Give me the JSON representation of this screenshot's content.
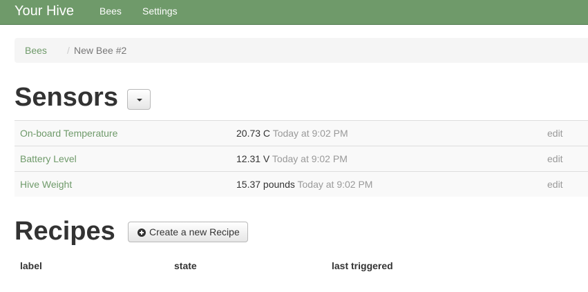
{
  "navbar": {
    "brand": "Your Hive",
    "links": [
      "Bees",
      "Settings"
    ]
  },
  "breadcrumb": {
    "items": [
      "Bees",
      "New Bee #2"
    ],
    "separator": "/"
  },
  "sensors": {
    "heading": "Sensors",
    "dropdown_icon": "caret-down-icon",
    "rows": [
      {
        "name": "On-board Temperature",
        "value": "20.73 C",
        "time": "Today at 9:02 PM",
        "action": "edit"
      },
      {
        "name": "Battery Level",
        "value": "12.31 V",
        "time": "Today at 9:02 PM",
        "action": "edit"
      },
      {
        "name": "Hive Weight",
        "value": "15.37 pounds",
        "time": "Today at 9:02 PM",
        "action": "edit"
      }
    ]
  },
  "recipes": {
    "heading": "Recipes",
    "create_button": "Create a new Recipe",
    "create_icon": "plus-circle-icon",
    "columns": [
      "label",
      "state",
      "last triggered"
    ]
  },
  "colors": {
    "navbar": "#6f9a6a",
    "link": "#6f9a6a",
    "muted": "#999999"
  }
}
